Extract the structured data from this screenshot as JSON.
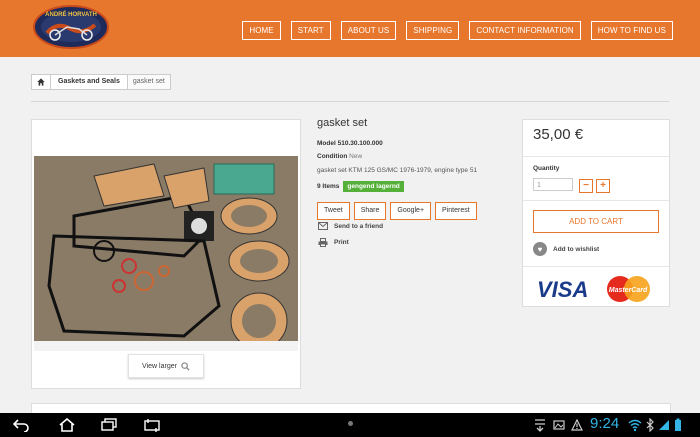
{
  "nav": [
    "HOME",
    "START",
    "ABOUT US",
    "SHIPPING",
    "CONTACT INFORMATION",
    "HOW TO FIND US"
  ],
  "logo": {
    "text": "ANDRÉ HORVATH"
  },
  "breadcrumb": {
    "items": [
      "Gaskets and Seals"
    ],
    "current": "gasket set"
  },
  "image": {
    "view_larger": "View larger"
  },
  "product": {
    "title": "gasket set",
    "model_label": "Model",
    "model_value": "510.30.100.000",
    "condition_label": "Condition",
    "condition_value": "New",
    "description": "gasket set KTM 125 GS/MC 1976-1979, engine type 51",
    "stock_count": "9 Items",
    "stock_badge": "gengend lagernd",
    "share": [
      "Tweet",
      "Share",
      "Google+",
      "Pinterest"
    ],
    "send_friend": "Send to a friend",
    "print": "Print"
  },
  "buy": {
    "price": "35,00 €",
    "quantity_label": "Quantity",
    "quantity_value": "1",
    "add_to_cart": "ADD TO CART",
    "wishlist": "Add to wishlist",
    "cards": {
      "visa": "VISA",
      "mastercard": "MasterCard"
    }
  },
  "system": {
    "clock": "9:24"
  },
  "colors": {
    "accent": "#e8772e",
    "stock": "#55b03a",
    "clock": "#33b5e5"
  }
}
